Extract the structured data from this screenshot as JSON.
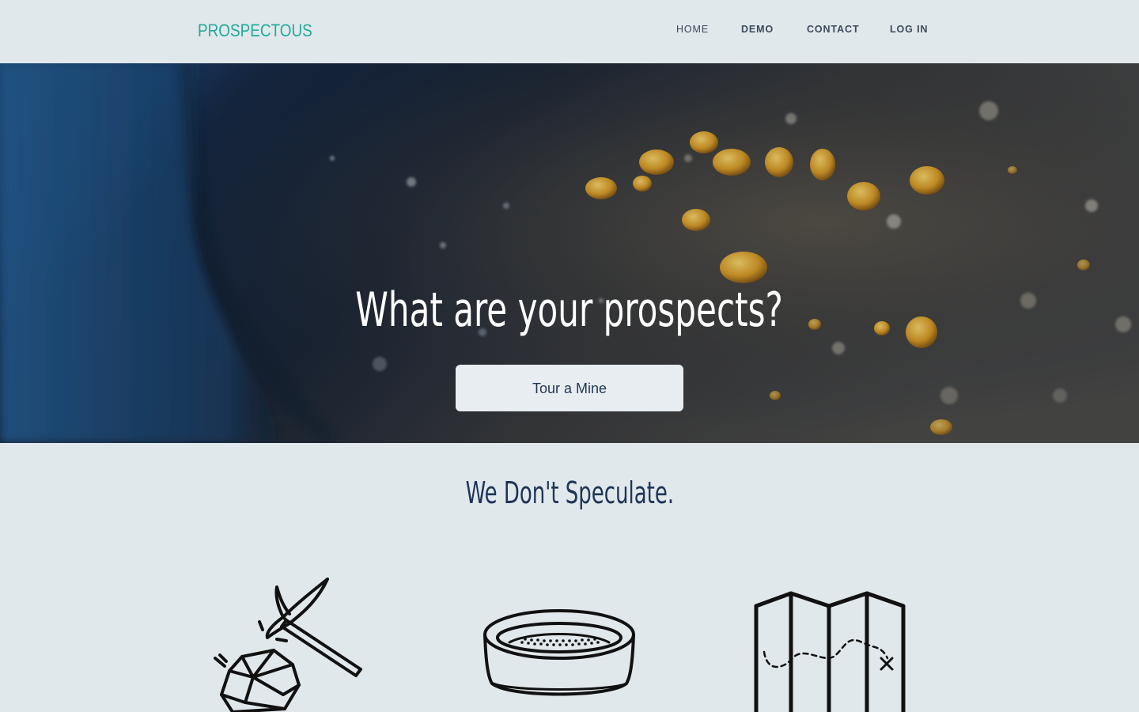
{
  "nav": {
    "brand": "PROSPECTOUS",
    "links": [
      {
        "label": "HOME"
      },
      {
        "label": "DEMO"
      },
      {
        "label": "CONTACT"
      },
      {
        "label": "LOG IN"
      }
    ]
  },
  "hero": {
    "title": "What are your prospects?",
    "button_label": "Tour a Mine"
  },
  "section": {
    "tagline": "We Don't Speculate.",
    "icons": [
      "pickaxe-rock-icon",
      "gold-pan-icon",
      "treasure-map-icon"
    ]
  },
  "colors": {
    "brand": "#21a99a",
    "nav_bg": "#e1e8ec",
    "heading": "#1e3556",
    "button_bg": "#e8edf1"
  }
}
